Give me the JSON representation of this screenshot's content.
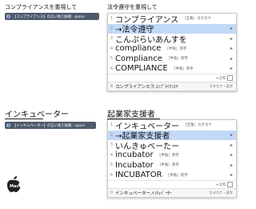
{
  "top": {
    "heading_left": "コンプライアンスを重視して",
    "tip": "【コンプライアンス】の言い換え候補：space",
    "heading_right": "法令遵守を重視して",
    "candidates": [
      {
        "num": "1",
        "text": "コンプライアンス",
        "ann": "［全角］カタカナ",
        "arrow": ""
      },
      {
        "num": "2",
        "text": "→法令遵守",
        "ann": "",
        "arrow": "▸"
      },
      {
        "num": "3",
        "text": "こんぷらいあんすを",
        "ann": "",
        "arrow": "▸"
      },
      {
        "num": "4",
        "text": "compliance",
        "ann": "［半角］英字",
        "arrow": "▸"
      },
      {
        "num": "5",
        "text": "Compliance",
        "ann": "［半角］英字",
        "arrow": "▸"
      },
      {
        "num": "6",
        "text": "COMPLIANCE",
        "ann": "［半角］英字",
        "arrow": "▸"
      }
    ],
    "count": "2/6",
    "bottom_num": "8",
    "bottom_text": "コンプライアンスヲ,ｺﾝﾌﾟﾗｲｱﾝｽｦ",
    "bottom_right": "カタカナ・英字"
  },
  "bottom_section": {
    "heading_left": "インキュベーター",
    "tip": "【インキュベーター】の言い換え候補：space",
    "heading_right": "起業家支援者",
    "candidates": [
      {
        "num": "1",
        "text": "インキュベーター",
        "ann": "［全角］カタカナ",
        "arrow": ""
      },
      {
        "num": "2",
        "text": "→起業家支援者",
        "ann": "",
        "arrow": "▸"
      },
      {
        "num": "3",
        "text": "いんきゅべーたー",
        "ann": "",
        "arrow": "▸"
      },
      {
        "num": "4",
        "text": "incubator",
        "ann": "［半角］英字",
        "arrow": "▸"
      },
      {
        "num": "5",
        "text": "Incubator",
        "ann": "［半角］英字",
        "arrow": "▸"
      },
      {
        "num": "6",
        "text": "INCUBATOR",
        "ann": "［半角］英字",
        "arrow": "▸"
      }
    ],
    "count": "2/6",
    "bottom_num": "0",
    "bottom_text": "インキュベーター,ｲﾝｷｭﾍﾞｰﾀｰ",
    "bottom_right": "カタカナ・英字"
  },
  "logo_text": "Mac",
  "colors": {
    "selected_row": "#c2d9f7",
    "tip_bg": "#4d5b6c"
  }
}
